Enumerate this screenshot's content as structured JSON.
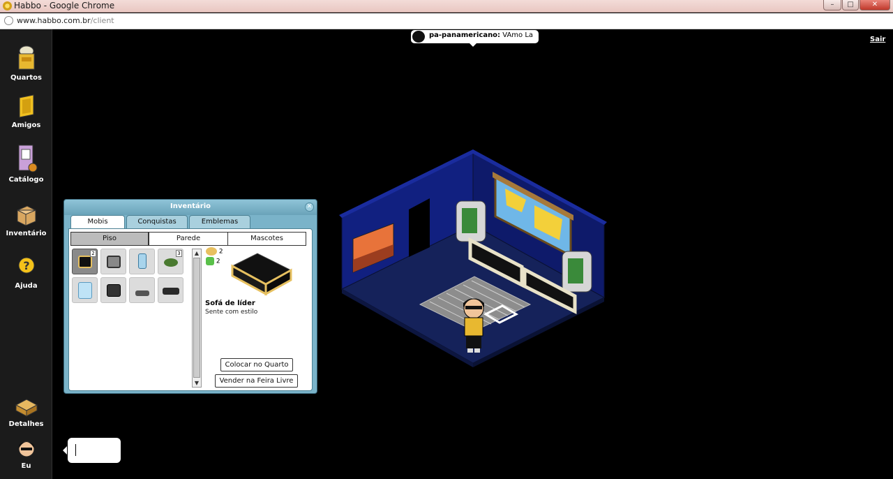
{
  "window": {
    "title": "Habbo - Google Chrome",
    "minimize": "–",
    "maximize": "□",
    "close": "✕"
  },
  "address": {
    "host": "www.habbo.com.br",
    "path": "/client"
  },
  "toolbar": {
    "quartos": "Quartos",
    "amigos": "Amigos",
    "catalogo": "Catálogo",
    "inventario": "Inventário",
    "ajuda": "Ajuda",
    "detalhes": "Detalhes",
    "eu": "Eu"
  },
  "room": {
    "sair": "Sair",
    "speech_user": "pa-panamericano:",
    "speech_text": "VAmo La"
  },
  "inventory": {
    "title": "Inventário",
    "close": "✕",
    "tabs": [
      "Mobis",
      "Conquistas",
      "Emblemas"
    ],
    "subtabs": [
      "Piso",
      "Parede",
      "Mascotes"
    ],
    "slot_badges": [
      "2",
      "3"
    ],
    "counts": [
      "2",
      "2"
    ],
    "item_name": "Sofá de líder",
    "item_desc": "Sente com estilo",
    "place_button": "Colocar no Quarto",
    "sell_button": "Vender na Feira Livre",
    "scroll_up": "▲",
    "scroll_down": "▼"
  },
  "colors": {
    "room_floor": "#14214f",
    "room_wall": "#0d1a5e",
    "panel_blue": "#7ab3c9"
  }
}
